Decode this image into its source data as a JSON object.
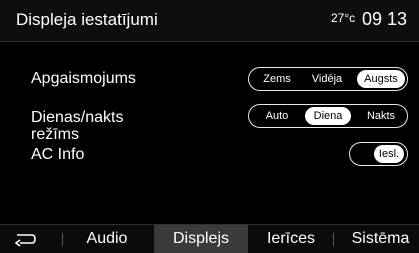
{
  "header": {
    "title": "Displeja iestatījumi",
    "temperature": "27°c",
    "time": "09 13"
  },
  "settings": {
    "lighting": {
      "label": "Apgaismojums",
      "options": [
        "Zems",
        "Vidēja",
        "Augsts"
      ],
      "selected": "Augsts"
    },
    "daynight": {
      "label": "Dienas/nakts režīms",
      "options": [
        "Auto",
        "Diena",
        "Nakts"
      ],
      "selected": "Diena"
    },
    "acinfo": {
      "label": "AC Info",
      "toggle": "Iesl."
    }
  },
  "bottom_nav": {
    "back_icon": "back-arrow-icon",
    "tabs": [
      "Audio",
      "Displejs",
      "Ierīces",
      "Sistēma"
    ],
    "active": "Displejs"
  }
}
